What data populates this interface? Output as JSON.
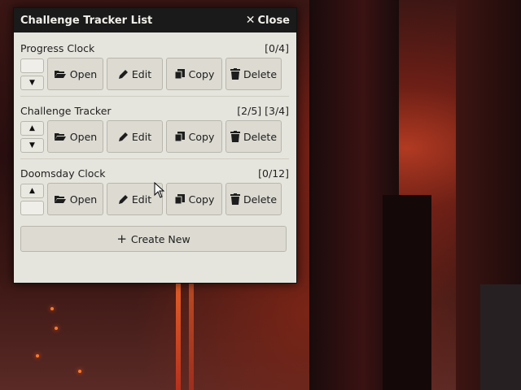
{
  "window": {
    "title": "Challenge Tracker List",
    "close_label": "Close"
  },
  "trackers": [
    {
      "name": "Progress Clock",
      "value": "[0/4]",
      "up": false,
      "down": true
    },
    {
      "name": "Challenge Tracker",
      "value": "[2/5] [3/4]",
      "up": true,
      "down": true
    },
    {
      "name": "Doomsday Clock",
      "value": "[0/12]",
      "up": true,
      "down": false
    }
  ],
  "actions": {
    "open": "Open",
    "edit": "Edit",
    "copy": "Copy",
    "delete": "Delete"
  },
  "create_label": "Create New",
  "colors": {
    "titlebar": "#1a1a1a",
    "panel": "#e6e5dd",
    "button": "#dcdad1"
  }
}
